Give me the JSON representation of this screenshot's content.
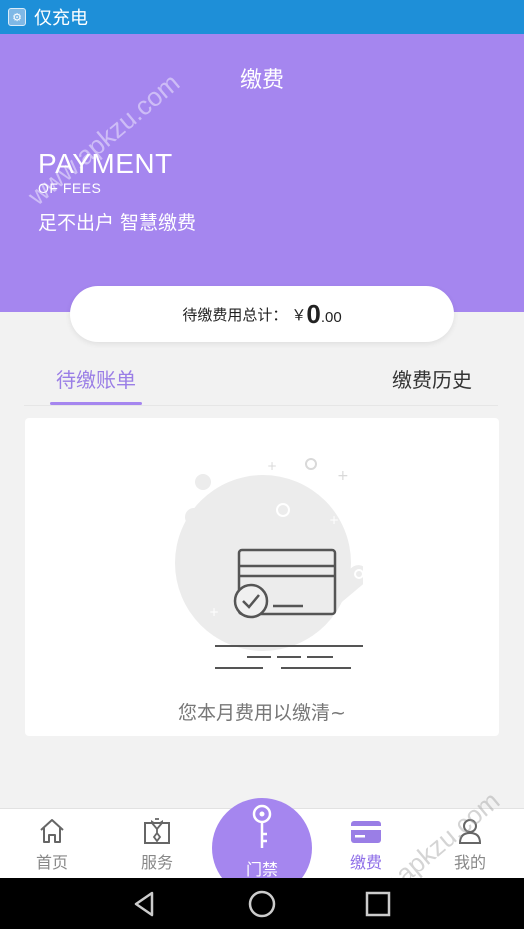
{
  "status_bar": {
    "app_label": "仅充电",
    "color": "#1e8fd8"
  },
  "header": {
    "title": "缴费",
    "payment_en": "PAYMENT",
    "of_fees_en": "OF FEES",
    "slogan": "足不出户 智慧缴费",
    "color": "#a586ef"
  },
  "total": {
    "label": "待缴费用总计：",
    "currency": "￥",
    "amount_int": "0",
    "amount_dec": ".00"
  },
  "tabs": [
    {
      "label": "待缴账单",
      "active": true
    },
    {
      "label": "缴费历史",
      "active": false
    }
  ],
  "empty_state": {
    "message": "您本月费用以缴清~"
  },
  "bottom_nav": [
    {
      "label": "首页",
      "icon": "home-icon",
      "active": false
    },
    {
      "label": "服务",
      "icon": "service-icon",
      "active": false
    },
    {
      "label": "门禁",
      "icon": "key-icon",
      "active": false
    },
    {
      "label": "缴费",
      "icon": "card-icon",
      "active": true
    },
    {
      "label": "我的",
      "icon": "user-icon",
      "active": false
    }
  ],
  "watermarks": [
    "www.apkzu.com",
    "www.apkzu.com"
  ],
  "accent_color": "#a586ef"
}
